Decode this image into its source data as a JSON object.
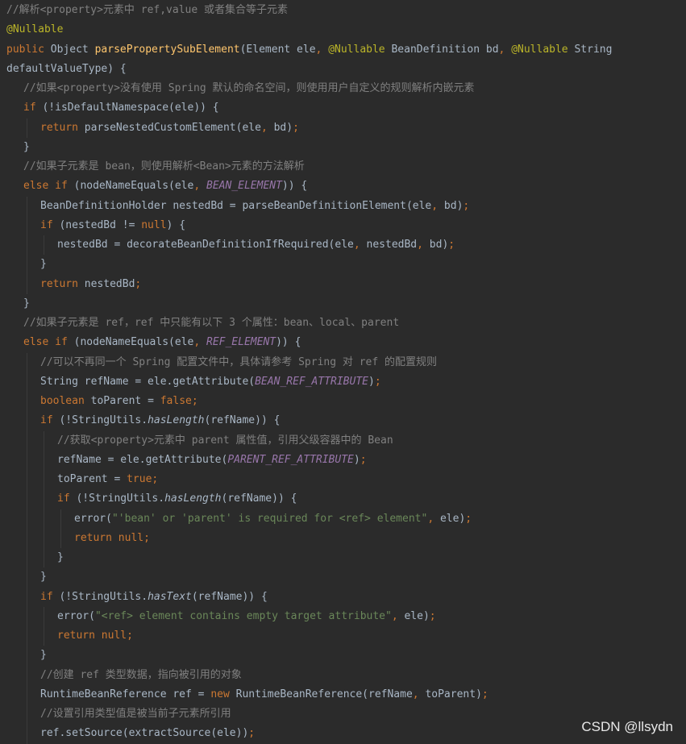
{
  "colors": {
    "background": "#2b2b2b",
    "plain": "#a9b7c6",
    "comment": "#808080",
    "keyword": "#cc7832",
    "annotation": "#bbb529",
    "method": "#ffc66d",
    "constant": "#9876aa",
    "string": "#6a8759"
  },
  "watermark": "CSDN @llsydn",
  "lines": [
    {
      "indent": 0,
      "tokens": [
        {
          "t": "comment",
          "v": "//解析<property>元素中 ref,value 或者集合等子元素"
        }
      ]
    },
    {
      "indent": 0,
      "tokens": [
        {
          "t": "annotation",
          "v": "@Nullable"
        }
      ]
    },
    {
      "indent": 0,
      "tokens": [
        {
          "t": "keyword",
          "v": "public "
        },
        {
          "t": "plain",
          "v": "Object "
        },
        {
          "t": "method",
          "v": "parsePropertySubElement"
        },
        {
          "t": "plain",
          "v": "(Element ele"
        },
        {
          "t": "keyword",
          "v": ", "
        },
        {
          "t": "annotation",
          "v": "@Nullable "
        },
        {
          "t": "plain",
          "v": "BeanDefinition bd"
        },
        {
          "t": "keyword",
          "v": ", "
        },
        {
          "t": "annotation",
          "v": "@Nullable "
        },
        {
          "t": "plain",
          "v": "String"
        }
      ]
    },
    {
      "indent": 0,
      "tokens": [
        {
          "t": "plain",
          "v": "defaultValueType) {"
        }
      ]
    },
    {
      "indent": 1,
      "tokens": [
        {
          "t": "comment",
          "v": "//如果<property>没有使用 Spring 默认的命名空间，则使用用户自定义的规则解析内嵌元素"
        }
      ]
    },
    {
      "indent": 1,
      "tokens": [
        {
          "t": "keyword",
          "v": "if "
        },
        {
          "t": "plain",
          "v": "(!isDefaultNamespace(ele)) {"
        }
      ]
    },
    {
      "indent": 2,
      "tokens": [
        {
          "t": "keyword",
          "v": "return "
        },
        {
          "t": "plain",
          "v": "parseNestedCustomElement(ele"
        },
        {
          "t": "keyword",
          "v": ", "
        },
        {
          "t": "plain",
          "v": "bd)"
        },
        {
          "t": "keyword",
          "v": ";"
        }
      ]
    },
    {
      "indent": 1,
      "tokens": [
        {
          "t": "plain",
          "v": "}"
        }
      ]
    },
    {
      "indent": 1,
      "tokens": [
        {
          "t": "comment",
          "v": "//如果子元素是 bean，则使用解析<Bean>元素的方法解析"
        }
      ]
    },
    {
      "indent": 1,
      "tokens": [
        {
          "t": "keyword",
          "v": "else if "
        },
        {
          "t": "plain",
          "v": "(nodeNameEquals(ele"
        },
        {
          "t": "keyword",
          "v": ", "
        },
        {
          "t": "constant",
          "v": "BEAN_ELEMENT"
        },
        {
          "t": "plain",
          "v": ")) {"
        }
      ]
    },
    {
      "indent": 2,
      "tokens": [
        {
          "t": "plain",
          "v": "BeanDefinitionHolder nestedBd = parseBeanDefinitionElement(ele"
        },
        {
          "t": "keyword",
          "v": ", "
        },
        {
          "t": "plain",
          "v": "bd)"
        },
        {
          "t": "keyword",
          "v": ";"
        }
      ]
    },
    {
      "indent": 2,
      "tokens": [
        {
          "t": "keyword",
          "v": "if "
        },
        {
          "t": "plain",
          "v": "(nestedBd != "
        },
        {
          "t": "keyword",
          "v": "null"
        },
        {
          "t": "plain",
          "v": ") {"
        }
      ]
    },
    {
      "indent": 3,
      "tokens": [
        {
          "t": "plain",
          "v": "nestedBd = decorateBeanDefinitionIfRequired(ele"
        },
        {
          "t": "keyword",
          "v": ", "
        },
        {
          "t": "plain",
          "v": "nestedBd"
        },
        {
          "t": "keyword",
          "v": ", "
        },
        {
          "t": "plain",
          "v": "bd)"
        },
        {
          "t": "keyword",
          "v": ";"
        }
      ]
    },
    {
      "indent": 2,
      "tokens": [
        {
          "t": "plain",
          "v": "}"
        }
      ]
    },
    {
      "indent": 2,
      "tokens": [
        {
          "t": "keyword",
          "v": "return "
        },
        {
          "t": "plain",
          "v": "nestedBd"
        },
        {
          "t": "keyword",
          "v": ";"
        }
      ]
    },
    {
      "indent": 1,
      "tokens": [
        {
          "t": "plain",
          "v": "}"
        }
      ]
    },
    {
      "indent": 1,
      "tokens": [
        {
          "t": "comment",
          "v": "//如果子元素是 ref，ref 中只能有以下 3 个属性：bean、local、parent"
        }
      ]
    },
    {
      "indent": 1,
      "tokens": [
        {
          "t": "keyword",
          "v": "else if "
        },
        {
          "t": "plain",
          "v": "(nodeNameEquals(ele"
        },
        {
          "t": "keyword",
          "v": ", "
        },
        {
          "t": "constant",
          "v": "REF_ELEMENT"
        },
        {
          "t": "plain",
          "v": ")) {"
        }
      ]
    },
    {
      "indent": 2,
      "tokens": [
        {
          "t": "comment",
          "v": "//可以不再同一个 Spring 配置文件中，具体请参考 Spring 对 ref 的配置规则"
        }
      ]
    },
    {
      "indent": 2,
      "tokens": [
        {
          "t": "plain",
          "v": "String refName = ele.getAttribute("
        },
        {
          "t": "constant",
          "v": "BEAN_REF_ATTRIBUTE"
        },
        {
          "t": "plain",
          "v": ")"
        },
        {
          "t": "keyword",
          "v": ";"
        }
      ]
    },
    {
      "indent": 2,
      "tokens": [
        {
          "t": "keyword",
          "v": "boolean "
        },
        {
          "t": "plain",
          "v": "toParent = "
        },
        {
          "t": "keyword",
          "v": "false;"
        }
      ]
    },
    {
      "indent": 2,
      "tokens": [
        {
          "t": "keyword",
          "v": "if "
        },
        {
          "t": "plain",
          "v": "(!StringUtils."
        },
        {
          "t": "static",
          "v": "hasLength"
        },
        {
          "t": "plain",
          "v": "(refName)) {"
        }
      ]
    },
    {
      "indent": 3,
      "tokens": [
        {
          "t": "comment",
          "v": "//获取<property>元素中 parent 属性值，引用父级容器中的 Bean"
        }
      ]
    },
    {
      "indent": 3,
      "tokens": [
        {
          "t": "plain",
          "v": "refName = ele.getAttribute("
        },
        {
          "t": "constant",
          "v": "PARENT_REF_ATTRIBUTE"
        },
        {
          "t": "plain",
          "v": ")"
        },
        {
          "t": "keyword",
          "v": ";"
        }
      ]
    },
    {
      "indent": 3,
      "tokens": [
        {
          "t": "plain",
          "v": "toParent = "
        },
        {
          "t": "keyword",
          "v": "true;"
        }
      ]
    },
    {
      "indent": 3,
      "tokens": [
        {
          "t": "keyword",
          "v": "if "
        },
        {
          "t": "plain",
          "v": "(!StringUtils."
        },
        {
          "t": "static",
          "v": "hasLength"
        },
        {
          "t": "plain",
          "v": "(refName)) {"
        }
      ]
    },
    {
      "indent": 4,
      "tokens": [
        {
          "t": "plain",
          "v": "error("
        },
        {
          "t": "string",
          "v": "\"'bean' or 'parent' is required for <ref> element\""
        },
        {
          "t": "keyword",
          "v": ", "
        },
        {
          "t": "plain",
          "v": "ele)"
        },
        {
          "t": "keyword",
          "v": ";"
        }
      ]
    },
    {
      "indent": 4,
      "tokens": [
        {
          "t": "keyword",
          "v": "return null;"
        }
      ]
    },
    {
      "indent": 3,
      "tokens": [
        {
          "t": "plain",
          "v": "}"
        }
      ]
    },
    {
      "indent": 2,
      "tokens": [
        {
          "t": "plain",
          "v": "}"
        }
      ]
    },
    {
      "indent": 2,
      "tokens": [
        {
          "t": "keyword",
          "v": "if "
        },
        {
          "t": "plain",
          "v": "(!StringUtils."
        },
        {
          "t": "static",
          "v": "hasText"
        },
        {
          "t": "plain",
          "v": "(refName)) {"
        }
      ]
    },
    {
      "indent": 3,
      "tokens": [
        {
          "t": "plain",
          "v": "error("
        },
        {
          "t": "string",
          "v": "\"<ref> element contains empty target attribute\""
        },
        {
          "t": "keyword",
          "v": ", "
        },
        {
          "t": "plain",
          "v": "ele)"
        },
        {
          "t": "keyword",
          "v": ";"
        }
      ]
    },
    {
      "indent": 3,
      "tokens": [
        {
          "t": "keyword",
          "v": "return null;"
        }
      ]
    },
    {
      "indent": 2,
      "tokens": [
        {
          "t": "plain",
          "v": "}"
        }
      ]
    },
    {
      "indent": 2,
      "tokens": [
        {
          "t": "comment",
          "v": "//创建 ref 类型数据，指向被引用的对象"
        }
      ]
    },
    {
      "indent": 2,
      "tokens": [
        {
          "t": "plain",
          "v": "RuntimeBeanReference ref = "
        },
        {
          "t": "keyword",
          "v": "new "
        },
        {
          "t": "plain",
          "v": "RuntimeBeanReference(refName"
        },
        {
          "t": "keyword",
          "v": ", "
        },
        {
          "t": "plain",
          "v": "toParent)"
        },
        {
          "t": "keyword",
          "v": ";"
        }
      ]
    },
    {
      "indent": 2,
      "tokens": [
        {
          "t": "comment",
          "v": "//设置引用类型值是被当前子元素所引用"
        }
      ]
    },
    {
      "indent": 2,
      "tokens": [
        {
          "t": "plain",
          "v": "ref.setSource(extractSource(ele))"
        },
        {
          "t": "keyword",
          "v": ";"
        }
      ]
    }
  ]
}
